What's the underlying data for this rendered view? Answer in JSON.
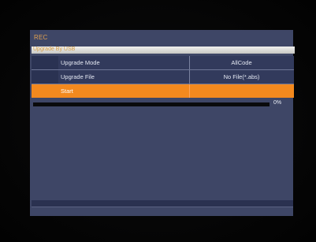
{
  "header": {
    "title": "REC"
  },
  "section": {
    "label": "Upgrade By USB"
  },
  "rows": [
    {
      "label": "Upgrade Mode",
      "value": "AllCode"
    },
    {
      "label": "Upgrade File",
      "value": "No File(*.abs)"
    },
    {
      "label": "Start",
      "value": ""
    }
  ],
  "progress": {
    "percent": 0,
    "text": "0%"
  },
  "colors": {
    "panel": "#3e4666",
    "accent": "#f3891e",
    "title": "#e0a050",
    "text": "#e4e8f2"
  }
}
